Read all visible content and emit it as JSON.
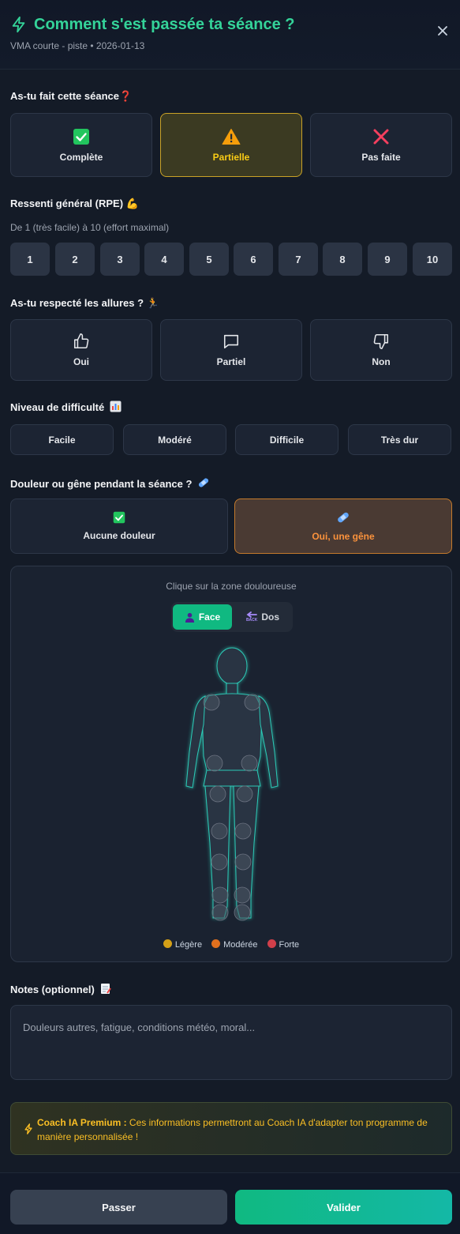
{
  "header": {
    "title": "Comment s'est passée ta séance ?",
    "subtitle": "VMA courte - piste • 2026-01-13"
  },
  "completion": {
    "label": "As-tu fait cette séance",
    "options": [
      {
        "label": "Complète",
        "icon": "check-box-icon"
      },
      {
        "label": "Partielle",
        "icon": "warning-icon",
        "selected": true
      },
      {
        "label": "Pas faite",
        "icon": "cross-icon"
      }
    ]
  },
  "rpe": {
    "label": "Ressenti général (RPE)",
    "hint": "De 1 (très facile) à 10 (effort maximal)",
    "values": [
      "1",
      "2",
      "3",
      "4",
      "5",
      "6",
      "7",
      "8",
      "9",
      "10"
    ]
  },
  "pace": {
    "label": "As-tu respecté les allures ?",
    "options": [
      {
        "label": "Oui",
        "icon": "thumbs-up-icon"
      },
      {
        "label": "Partiel",
        "icon": "speech-bubble-icon"
      },
      {
        "label": "Non",
        "icon": "thumbs-down-icon"
      }
    ]
  },
  "difficulty": {
    "label": "Niveau de difficulté",
    "options": [
      "Facile",
      "Modéré",
      "Difficile",
      "Très dur"
    ]
  },
  "pain": {
    "label": "Douleur ou gêne pendant la séance ?",
    "options": [
      {
        "label": "Aucune douleur",
        "icon": "check-box-icon"
      },
      {
        "label": "Oui, une gêne",
        "icon": "bandage-icon",
        "selected": true
      }
    ]
  },
  "body_map": {
    "hint": "Clique sur la zone douloureuse",
    "view_front": "Face",
    "view_back": "Dos",
    "back_icon_text": "BACK",
    "legend": [
      {
        "label": "Légère",
        "color": "#d4a017"
      },
      {
        "label": "Modérée",
        "color": "#e0701e"
      },
      {
        "label": "Forte",
        "color": "#d13f4a"
      }
    ]
  },
  "notes": {
    "label": "Notes (optionnel)",
    "placeholder": "Douleurs autres, fatigue, conditions météo, moral..."
  },
  "coach": {
    "strong": "Coach IA Premium :",
    "text": " Ces informations permettront au Coach IA d'adapter ton programme de manière personnalisée !"
  },
  "footer": {
    "skip": "Passer",
    "submit": "Valider"
  },
  "colors": {
    "accent": "#10b981",
    "warning": "#facc15",
    "orange": "#fb923c",
    "background": "#141b27"
  }
}
